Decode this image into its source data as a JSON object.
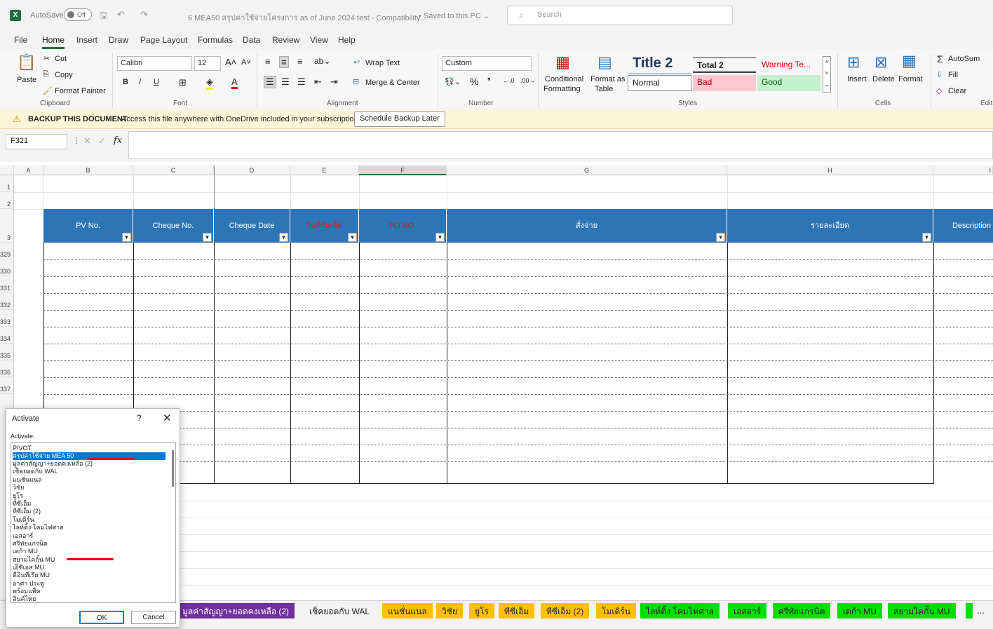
{
  "titlebar": {
    "app_icon": "X",
    "autosave_label": "AutoSave",
    "autosave_state": "Off",
    "undo_icon": "↶",
    "redo_icon": "↷",
    "document_title": "6  MEA50 สรุปค่าใช้จ่ายโครงการ  as of  June  2024 test  -  Compatibility...",
    "saved_status": "• Saved to this PC ⌄",
    "search_placeholder": "Search"
  },
  "menu": [
    "File",
    "Home",
    "Insert",
    "Draw",
    "Page Layout",
    "Formulas",
    "Data",
    "Review",
    "View",
    "Help"
  ],
  "ribbon": {
    "clipboard": {
      "paste": "Paste",
      "cut": "Cut",
      "copy": "Copy",
      "format_painter": "Format Painter",
      "label": "Clipboard"
    },
    "font": {
      "family": "Calibri",
      "size": "12",
      "bold": "B",
      "italic": "I",
      "underline": "U",
      "label": "Font"
    },
    "alignment": {
      "wrap": "Wrap Text",
      "merge": "Merge & Center",
      "label": "Alignment"
    },
    "number": {
      "format": "Custom",
      "percent": "%",
      "comma": "❜",
      "label": "Number"
    },
    "styles": {
      "conditional": "Conditional",
      "conditional2": "Formatting",
      "format_table": "Format as",
      "format_table2": "Table",
      "title2": "Title 2",
      "total2": "Total 2",
      "warning": "Warning Te...",
      "normal": "Normal",
      "bad": "Bad",
      "good": "Good",
      "label": "Styles"
    },
    "cells": {
      "insert": "Insert",
      "delete": "Delete",
      "format": "Format",
      "label": "Cells"
    },
    "editing": {
      "autosum": "AutoSum",
      "fill": "Fill",
      "clear": "Clear",
      "label": "Edit"
    }
  },
  "infobar": {
    "title": "BACKUP THIS DOCUMENT",
    "message": "Access this file anywhere with OneDrive included in your subscription.",
    "button": "Schedule Backup Later"
  },
  "formula": {
    "namebox": "F321",
    "fx": "fx"
  },
  "columns": [
    "A",
    "B",
    "C",
    "D",
    "E",
    "F",
    "G",
    "H",
    "I"
  ],
  "header_row": [
    "PV No.",
    "Cheque No.",
    "Cheque Date",
    "วันที่รับเช็ค",
    "PO NO.",
    "สั่งจ่าย",
    "รายละเอียด",
    "Description"
  ],
  "rows_top": [
    "1",
    "2",
    "3"
  ],
  "rows": [
    "329",
    "330",
    "331",
    "332",
    "333",
    "334",
    "335",
    "336",
    "337",
    "338"
  ],
  "sheet_tabs": [
    {
      "label": "มูลค่าสัญญา+ยอดคงเหลือ (2)",
      "color": "#7030a0",
      "text": "#ffffff"
    },
    {
      "label": "เช็คยอดกับ WAL",
      "color": "#f3f3f3",
      "text": "#222222"
    },
    {
      "label": "แนชั่นแนล",
      "color": "#ffc000",
      "text": "#222222"
    },
    {
      "label": "วิชัย",
      "color": "#ffc000",
      "text": "#222222"
    },
    {
      "label": "ยูโร",
      "color": "#ffc000",
      "text": "#222222"
    },
    {
      "label": "ทีซีเอ็ม",
      "color": "#ffc000",
      "text": "#222222"
    },
    {
      "label": "ทีซีเอ็ม (2)",
      "color": "#ffc000",
      "text": "#222222"
    },
    {
      "label": "โมเดิร์น",
      "color": "#ffc000",
      "text": "#222222"
    },
    {
      "label": "ไลท์ติ้ง โคมไฟศาล",
      "color": "#00e000",
      "text": "#222222"
    },
    {
      "label": "เอสอาร์",
      "color": "#00e000",
      "text": "#222222"
    },
    {
      "label": "ศรีทัยแกรนิต",
      "color": "#00e000",
      "text": "#222222"
    },
    {
      "label": "เตก้า MU",
      "color": "#00e000",
      "text": "#222222"
    },
    {
      "label": "สยามไคกั้น MU",
      "color": "#00e000",
      "text": "#222222"
    }
  ],
  "sheet_more": "...",
  "dialog": {
    "title": "Activate",
    "help": "?",
    "close": "✕",
    "list_label": "Activate:",
    "items": [
      "PIVOT",
      "สรุปค่าใช้จ่าย MEA 50",
      "มูลค่าสัญญา+ยอดคงเหลือ (2)",
      "เช็คยอดกับ WAL",
      "แนชั่นแนล",
      "วิชัย",
      "ยูโร",
      "ทีซีเอ็ม",
      "ทีซีเอ็ม (2)",
      "โมเดิร์น",
      "ไลท์ติ้ง โคมไฟศาล",
      "เอสอาร์",
      "ศรีทัยแกรนิต",
      "เตก้า MU",
      "สยามไคกั้น MU",
      "เอ็ซีเอส MU",
      "ดีอินทีเรีย MU",
      "อาศา ประตู",
      "พร้อมแพ็ค",
      "สินค์ไทย"
    ],
    "selected_index": 1,
    "ok": "OK",
    "cancel": "Cancel"
  }
}
